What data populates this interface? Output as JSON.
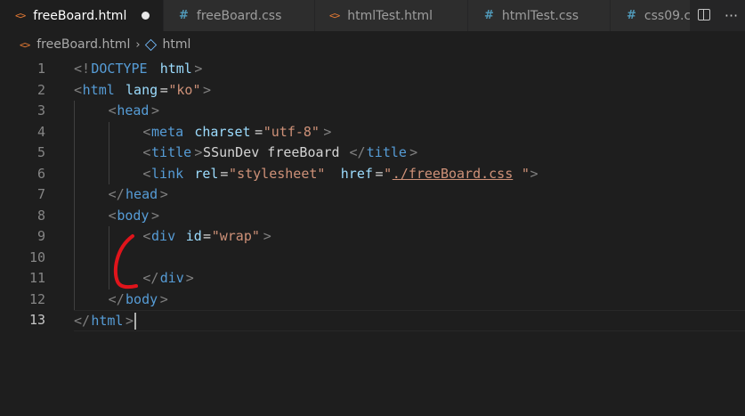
{
  "tabs": [
    {
      "label": "freeBoard.html",
      "icon": "html-file-icon",
      "active": true,
      "dirty": true
    },
    {
      "label": "freeBoard.css",
      "icon": "css-file-icon",
      "active": false
    },
    {
      "label": "htmlTest.html",
      "icon": "html-file-icon",
      "active": false
    },
    {
      "label": "htmlTest.css",
      "icon": "css-file-icon",
      "active": false
    },
    {
      "label": "css09.c",
      "icon": "css-file-icon",
      "active": false
    }
  ],
  "tab_icons": {
    "html": "<>",
    "css": "#"
  },
  "tab_actions": {
    "more": "···"
  },
  "breadcrumb": {
    "file": "freeBoard.html",
    "symbol": "html"
  },
  "editor": {
    "current_line": 13,
    "lines": [
      {
        "n": "1",
        "tokens": [
          [
            "<!",
            "punct"
          ],
          [
            "DOCTYPE",
            "tag"
          ],
          [
            " ",
            "text"
          ],
          [
            "html",
            "attr"
          ],
          [
            ">",
            "punct"
          ]
        ]
      },
      {
        "n": "2",
        "tokens": [
          [
            "<",
            "punct"
          ],
          [
            "html",
            "tag"
          ],
          [
            " ",
            "text"
          ],
          [
            "lang",
            "attr"
          ],
          [
            "=",
            "text"
          ],
          [
            "\"ko\"",
            "str"
          ],
          [
            ">",
            "punct"
          ]
        ]
      },
      {
        "n": "3",
        "tokens": [
          [
            "<",
            "punct"
          ],
          [
            "head",
            "tag"
          ],
          [
            ">",
            "punct"
          ]
        ]
      },
      {
        "n": "4",
        "tokens": [
          [
            "<",
            "punct"
          ],
          [
            "meta",
            "tag"
          ],
          [
            " ",
            "text"
          ],
          [
            "charset",
            "attr"
          ],
          [
            "=",
            "text"
          ],
          [
            "\"utf-8\"",
            "str"
          ],
          [
            ">",
            "punct"
          ]
        ]
      },
      {
        "n": "5",
        "tokens": [
          [
            "<",
            "punct"
          ],
          [
            "title",
            "tag"
          ],
          [
            ">",
            "punct"
          ],
          [
            "SSunDev freeBoard",
            "text"
          ],
          [
            "</",
            "punct"
          ],
          [
            "title",
            "tag"
          ],
          [
            ">",
            "punct"
          ]
        ]
      },
      {
        "n": "6",
        "tokens": [
          [
            "<",
            "punct"
          ],
          [
            "link",
            "tag"
          ],
          [
            " ",
            "text"
          ],
          [
            "rel",
            "attr"
          ],
          [
            "=",
            "text"
          ],
          [
            "\"stylesheet\"",
            "str"
          ],
          [
            " ",
            "text"
          ],
          [
            "href",
            "attr"
          ],
          [
            "=",
            "text"
          ],
          [
            "\"",
            "str"
          ],
          [
            "./freeBoard.css",
            "link"
          ],
          [
            "\"",
            "str"
          ],
          [
            ">",
            "punct"
          ]
        ]
      },
      {
        "n": "7",
        "tokens": [
          [
            "</",
            "punct"
          ],
          [
            "head",
            "tag"
          ],
          [
            ">",
            "punct"
          ]
        ]
      },
      {
        "n": "8",
        "tokens": [
          [
            "<",
            "punct"
          ],
          [
            "body",
            "tag"
          ],
          [
            ">",
            "punct"
          ]
        ]
      },
      {
        "n": "9",
        "tokens": [
          [
            "<",
            "punct"
          ],
          [
            "div",
            "tag"
          ],
          [
            " ",
            "text"
          ],
          [
            "id",
            "attr"
          ],
          [
            "=",
            "text"
          ],
          [
            "\"wrap\"",
            "str"
          ],
          [
            ">",
            "punct"
          ]
        ]
      },
      {
        "n": "10",
        "tokens": []
      },
      {
        "n": "11",
        "tokens": [
          [
            "</",
            "punct"
          ],
          [
            "div",
            "tag"
          ],
          [
            ">",
            "punct"
          ]
        ]
      },
      {
        "n": "12",
        "tokens": [
          [
            "</",
            "punct"
          ],
          [
            "body",
            "tag"
          ],
          [
            ">",
            "punct"
          ]
        ]
      },
      {
        "n": "13",
        "tokens": [
          [
            "</",
            "punct"
          ],
          [
            "html",
            "tag"
          ],
          [
            ">",
            "punct"
          ]
        ]
      }
    ]
  },
  "annotation": {
    "color": "#e0141b"
  }
}
